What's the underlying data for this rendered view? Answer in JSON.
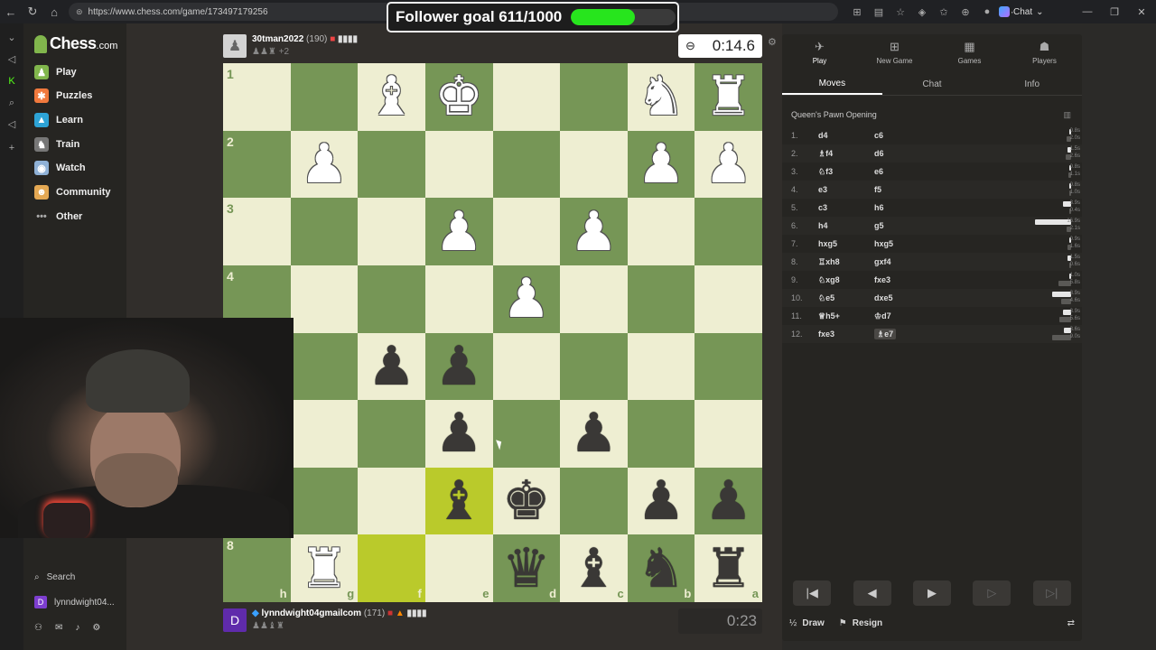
{
  "browser": {
    "url": "https://www.chess.com/game/173497179256",
    "chat_label": "Chat"
  },
  "overlay": {
    "follower_goal": "Follower goal 611/1000",
    "progress_fraction": 0.611
  },
  "sidebar": {
    "logo_word": "Chess",
    "logo_domain": ".com",
    "items": [
      {
        "label": "Play",
        "icon": "play-icon"
      },
      {
        "label": "Puzzles",
        "icon": "puzzle-icon"
      },
      {
        "label": "Learn",
        "icon": "learn-icon"
      },
      {
        "label": "Train",
        "icon": "train-icon"
      },
      {
        "label": "Watch",
        "icon": "watch-icon"
      },
      {
        "label": "Community",
        "icon": "community-icon"
      },
      {
        "label": "Other",
        "icon": "more-icon"
      }
    ],
    "search_label": "Search",
    "user_initial": "D",
    "user_label": "lynndwight04..."
  },
  "top_player": {
    "name": "30tman2022",
    "rating": "(190)",
    "captured": "+2",
    "clock": "0:14.6"
  },
  "bottom_player": {
    "initial": "D",
    "name": "lynndwight04gmailcom",
    "rating": "(171)",
    "clock": "0:23"
  },
  "board": {
    "ranks": [
      "1",
      "2",
      "3",
      "4",
      "5",
      "6",
      "7",
      "8"
    ],
    "files": [
      "h",
      "g",
      "f",
      "e",
      "d",
      "c",
      "b",
      "a"
    ],
    "rows": [
      [
        "",
        "",
        "wB",
        "wK",
        "",
        "",
        "wN",
        "wR"
      ],
      [
        "",
        "wP",
        "",
        "",
        "",
        "",
        "wP",
        "wP"
      ],
      [
        "",
        "",
        "",
        "wP",
        "",
        "wP",
        "",
        ""
      ],
      [
        "",
        "",
        "",
        "",
        "wP",
        "",
        "",
        ""
      ],
      [
        "",
        "",
        "bP",
        "bP",
        "",
        "",
        "",
        ""
      ],
      [
        "",
        "",
        "",
        "bP",
        "",
        "bP",
        "",
        ""
      ],
      [
        "",
        "",
        "",
        "bB",
        "bK",
        "",
        "bP",
        "bP"
      ],
      [
        "",
        "wR",
        "",
        "",
        "bQ",
        "bB",
        "bN",
        "bR"
      ]
    ],
    "highlights": [
      "6-3",
      "7-2"
    ]
  },
  "panel": {
    "tabs": [
      {
        "label": "Play",
        "icon": "play-icon",
        "active": true
      },
      {
        "label": "New Game",
        "icon": "plus-icon",
        "active": false
      },
      {
        "label": "Games",
        "icon": "board-icon",
        "active": false
      },
      {
        "label": "Players",
        "icon": "players-icon",
        "active": false
      }
    ],
    "subtabs": [
      {
        "label": "Moves",
        "active": true
      },
      {
        "label": "Chat",
        "active": false
      },
      {
        "label": "Info",
        "active": false
      }
    ],
    "opening": "Queen's Pawn Opening",
    "moves": [
      {
        "n": "1.",
        "w": "d4",
        "b": "c6",
        "wt": "0.8s",
        "bt": "2.0s",
        "wf": 0.05,
        "bf": 0.12
      },
      {
        "n": "2.",
        "w": "♗f4",
        "b": "d6",
        "wt": "1.5s",
        "bt": "2.6s",
        "wf": 0.09,
        "bf": 0.15
      },
      {
        "n": "3.",
        "w": "♘f3",
        "b": "e6",
        "wt": "0.8s",
        "bt": "1.1s",
        "wf": 0.05,
        "bf": 0.07
      },
      {
        "n": "4.",
        "w": "e3",
        "b": "f5",
        "wt": "0.8s",
        "bt": "1.0s",
        "wf": 0.05,
        "bf": 0.06
      },
      {
        "n": "5.",
        "w": "c3",
        "b": "h6",
        "wt": "3.9s",
        "bt": "0.4s",
        "wf": 0.23,
        "bf": 0.03
      },
      {
        "n": "6.",
        "w": "h4",
        "b": "g5",
        "wt": "16.9s",
        "bt": "2.1s",
        "wf": 1.0,
        "bf": 0.12
      },
      {
        "n": "7.",
        "w": "hxg5",
        "b": "hxg5",
        "wt": "0.9s",
        "bt": "1.6s",
        "wf": 0.05,
        "bf": 0.09
      },
      {
        "n": "8.",
        "w": "♖xh8",
        "b": "gxf4",
        "wt": "1.5s",
        "bt": "0.6s",
        "wf": 0.09,
        "bf": 0.04
      },
      {
        "n": "9.",
        "w": "♘xg8",
        "b": "fxe3",
        "wt": "1.0s",
        "bt": "5.8s",
        "wf": 0.06,
        "bf": 0.34
      },
      {
        "n": "10.",
        "w": "♘e5",
        "b": "dxe5",
        "wt": "8.9s",
        "bt": "4.6s",
        "wf": 0.53,
        "bf": 0.27
      },
      {
        "n": "11.",
        "w": "♕h5+",
        "b": "♔d7",
        "wt": "3.9s",
        "bt": "5.6s",
        "wf": 0.23,
        "bf": 0.33
      },
      {
        "n": "12.",
        "w": "fxe3",
        "b": "♗e7",
        "wt": "3.6s",
        "bt": "9.0s",
        "wf": 0.21,
        "bf": 0.53
      }
    ],
    "draw_label": "Draw",
    "resign_label": "Resign"
  },
  "colors": {
    "light_square": "#eeeed2",
    "dark_square": "#769656",
    "goal_fill": "#27e51d"
  }
}
